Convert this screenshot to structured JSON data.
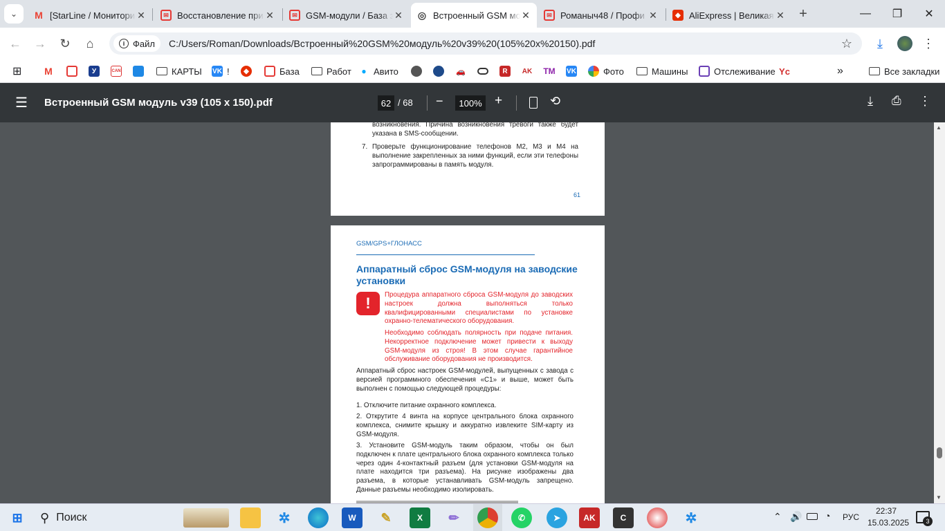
{
  "tabs": [
    {
      "title": "[StarLine / Мониторинг",
      "color": "#ea4335",
      "icon": "M"
    },
    {
      "title": "Восстановление при",
      "color": "#e53935",
      "icon": "✉"
    },
    {
      "title": "GSM-модули / База з",
      "color": "#e53935",
      "icon": "✉"
    },
    {
      "title": "Встроенный GSM мо",
      "color": "#5f6368",
      "icon": "◎"
    },
    {
      "title": "Романыч48 / Профи",
      "color": "#e53935",
      "icon": "✉"
    },
    {
      "title": "AliExpress | Великая",
      "color": "#e62e04",
      "icon": "◆"
    }
  ],
  "address": {
    "chip": "Файл",
    "url": "C:/Users/Roman/Downloads/Встроенный%20GSM%20модуль%20v39%20(105%20x%20150).pdf"
  },
  "bookmarks": [
    "КАРТЫ",
    "!",
    "База",
    "Работ",
    "Авито",
    "Фото",
    "Машины",
    "Отслеживание",
    "Все закладки"
  ],
  "pdf": {
    "title": "Встроенный GSM модуль v39 (105 x 150).pdf",
    "page": "62",
    "total": "/ 68",
    "zoom": "100%"
  },
  "page61": {
    "p_tail": "возникновения. Причина возникновения тревоги также будет указана в SMS-сообщении.",
    "item7_num": "7.",
    "item7": "Проверьте функционирование телефонов М2, М3 и М4 на выполнение закрепленных за ними функций, если эти телефоны запрограммированы в память модуля.",
    "page_num": "61"
  },
  "page62": {
    "header": "GSM/GPS+ГЛОНАСС",
    "heading": "Аппаратный сброс GSM-модуля на заводские установки",
    "warn1": "Процедура аппаратного сброса GSM-модуля до заводских настроек должна выполняться только квалифицированными специалистами по установке охранно-телематического оборудования.",
    "warn2": "Необходимо соблюдать полярность при подаче питания. Некорректное подключение может привести к выходу GSM-модуля из строя! В этом случае гарантийное обслуживание оборудования не производится.",
    "intro": "Аппаратный сброс настроек GSM-модулей, выпущенных с завода с версией программного обеспечения «С1» и выше, может быть выполнен с помощью следующей процедуры:",
    "step1": "1. Отключите питание охранного комплекса.",
    "step2": "2. Открутите 4 винта на корпусе центрального блока охранного комплекса, снимите крышку и аккуратно извлеките SIM-карту из GSM-модуля.",
    "step3": "3. Установите GSM-модуль таким образом, чтобы он был подключен к плате центрального блока охранного комплекса только через один 4-контактный разъем (для установки GSM-модуля на плате находится три разъема). На рисунке изображены два разъема, в которые устанавливать GSM-модуль запрещено. Данные разъемы необходимо изолировать."
  },
  "taskbar": {
    "search": "Поиск",
    "lang": "РУС",
    "time": "22:37",
    "date": "15.03.2025",
    "notif": "3"
  }
}
